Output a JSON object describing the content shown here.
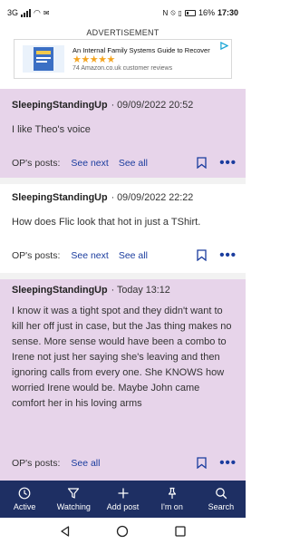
{
  "status_bar": {
    "left": "3G",
    "battery": "16%",
    "time": "17:30"
  },
  "ad": {
    "label": "ADVERTISEMENT",
    "title": "An Internal Family Systems Guide to Recover",
    "stars": "★★★★★",
    "rating": 4.5,
    "reviews": "74 Amazon.co.uk customer reviews"
  },
  "posts": [
    {
      "author": "SleepingStandingUp",
      "date": "· 09/09/2022 20:52",
      "text": "I like Theo's voice",
      "ops_label": "OP's posts:",
      "see_next": "See next",
      "see_all": "See all",
      "more": "•••"
    },
    {
      "author": "SleepingStandingUp",
      "date": "· 09/09/2022 22:22",
      "text": "How does Flic look that hot in just a TShirt.",
      "ops_label": "OP's posts:",
      "see_next": "See next",
      "see_all": "See all",
      "more": "•••"
    },
    {
      "author": "SleepingStandingUp",
      "date": "· Today 13:12",
      "text": "I know it was a tight spot and they didn't want to kill her off just in case, but the Jas thing makes no sense. More sense would have been a combo to Irene not just her saying she's leaving and then ignoring calls from every one. She KNOWS how worried Irene would be. Maybe John came comfort her in his loving arms",
      "ops_label": "OP's posts:",
      "see_all": "See all",
      "more": "•••"
    }
  ],
  "tabs": [
    {
      "label": "Active",
      "icon": "clock-icon"
    },
    {
      "label": "Watching",
      "icon": "filter-icon"
    },
    {
      "label": "Add post",
      "icon": "plus-icon"
    },
    {
      "label": "I'm on",
      "icon": "pin-icon"
    },
    {
      "label": "Search",
      "icon": "search-icon"
    }
  ],
  "colors": {
    "pink": "#e7d4ea",
    "link": "#1a3c9e",
    "tabbar": "#1e2f63"
  }
}
